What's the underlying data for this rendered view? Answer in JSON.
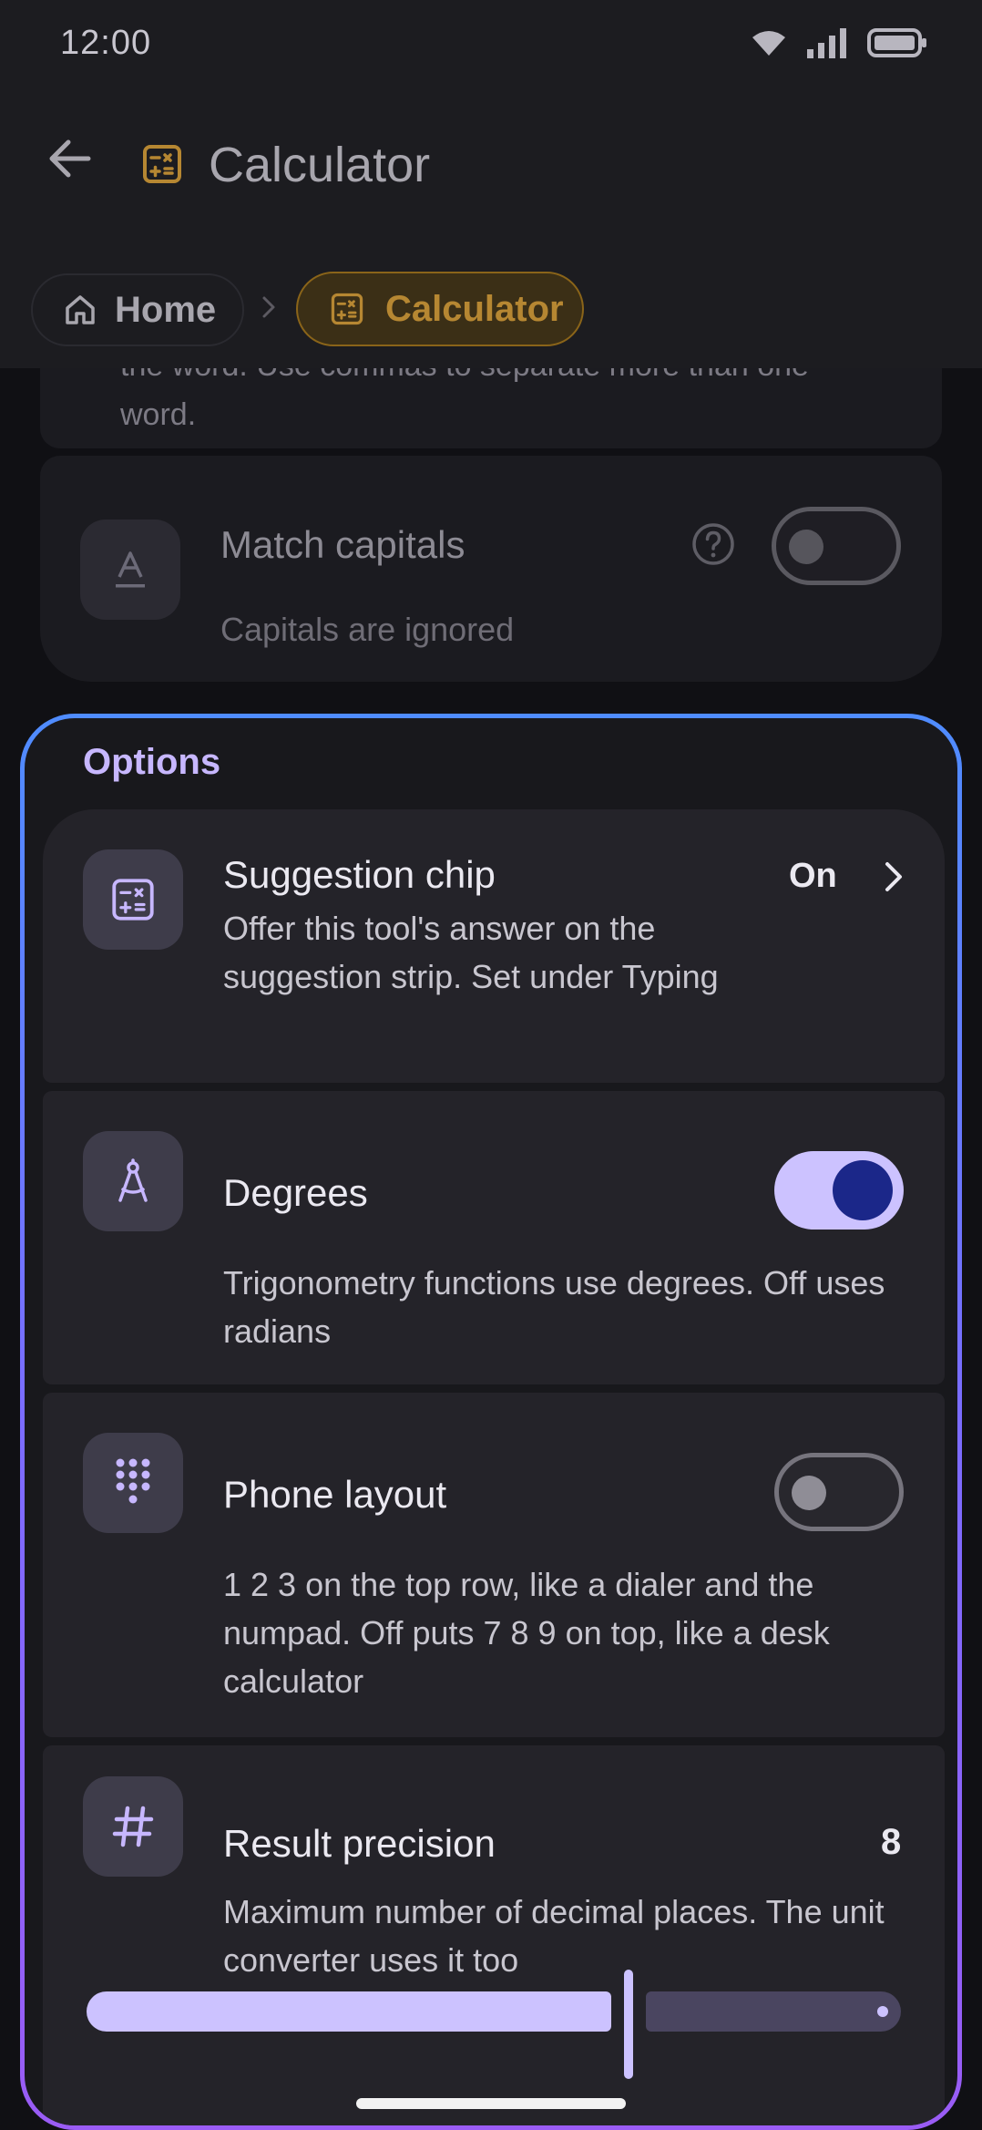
{
  "status_bar": {
    "time": "12:00"
  },
  "app_bar": {
    "title": "Calculator"
  },
  "breadcrumb": {
    "home": "Home",
    "current": "Calculator"
  },
  "behind": {
    "faded_text": "the word. Use commas to separate more than one word.",
    "match_capitals": {
      "title": "Match capitals",
      "subtitle": "Capitals are ignored",
      "enabled": false
    }
  },
  "options": {
    "title": "Options",
    "suggestion_chip": {
      "title": "Suggestion chip",
      "value": "On",
      "description": "Offer this tool's answer on the suggestion strip. Set under Typing"
    },
    "degrees": {
      "title": "Degrees",
      "description": "Trigonometry functions use degrees. Off uses radians",
      "enabled": true
    },
    "phone_layout": {
      "title": "Phone layout",
      "description": "1 2 3 on the top row, like a dialer and the numpad. Off puts 7 8 9 on top, like a desk calculator",
      "enabled": false
    },
    "result_precision": {
      "title": "Result precision",
      "value": "8",
      "description": "Maximum number of decimal places. The unit converter uses it too",
      "slider_fraction": 0.66
    }
  },
  "colors": {
    "accent": "#ccc2ff",
    "knob_on": "#1b2789",
    "breadcrumb_accent": "#b68732",
    "group_border_top": "#4f8cff",
    "group_border_bottom": "#9a5cf5"
  }
}
